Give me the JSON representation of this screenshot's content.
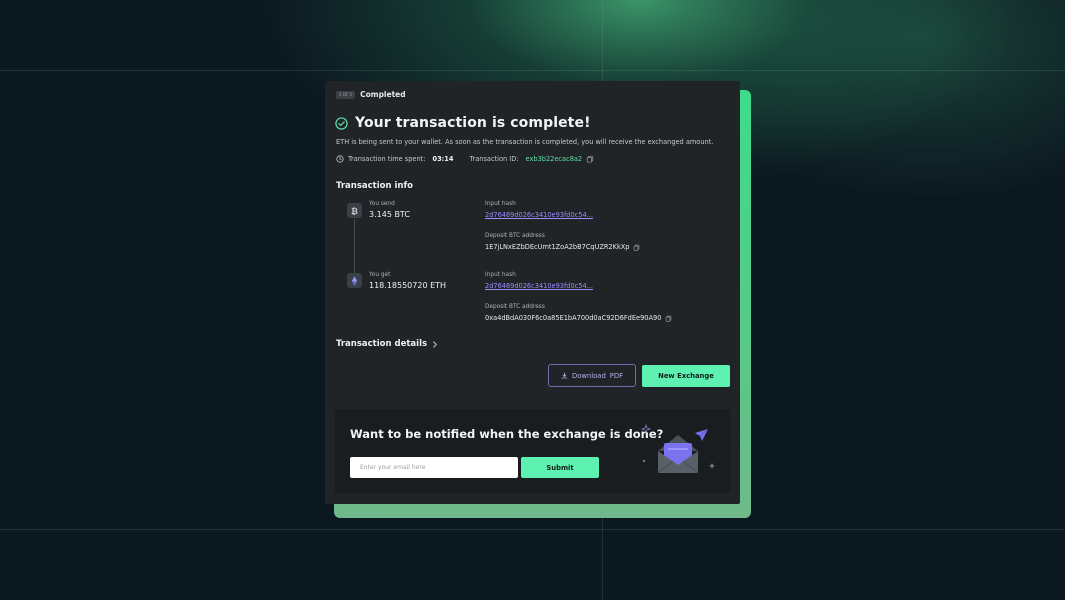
{
  "step": {
    "badge": "5 OF 5",
    "label": "Completed"
  },
  "header": {
    "title": "Your transaction is complete!",
    "subtitle": "ETH is being sent to your wallet. As soon as the transaction is completed, you will receive the exchanged amount."
  },
  "meta": {
    "time_label": "Transaction time spent:",
    "time_value": "03:14",
    "id_label": "Transaction ID:",
    "id_value": "exb3b22ecac8a2"
  },
  "transaction_info": {
    "title": "Transaction info",
    "send": {
      "label": "You send",
      "amount": "3.145 BTC",
      "hash_label": "Input hash",
      "hash": "2d76469d026c3410e93fd0c54...",
      "address_label": "Deposit BTC address",
      "address": "1E7jLNxEZbDEcUmt1ZoA2bB7CqUZR2KkXp"
    },
    "get": {
      "label": "You get",
      "amount": "118.18550720 ETH",
      "hash_label": "Input hash",
      "hash": "2d76469d026c3410e93fd0c54...",
      "address_label": "Deposit BTC address",
      "address": "0xa4dBdA030F6c0a85E1bA700d0aC92D6FdEe90A90"
    }
  },
  "details": {
    "label": "Transaction details"
  },
  "actions": {
    "download_label": "Download",
    "download_suffix": "PDF",
    "new_exchange_label": "New Exchange"
  },
  "notify": {
    "title": "Want to be notified when the exchange is done?",
    "email_placeholder": "Enter your email here",
    "submit_label": "Submit"
  },
  "colors": {
    "accent_green": "#5ef2b2",
    "link_purple": "#9b8cff",
    "card_bg": "#202427"
  },
  "icons": {
    "check": "check-circle-icon",
    "clock": "clock-icon",
    "copy": "copy-icon",
    "bitcoin": "bitcoin-icon",
    "ethereum": "ethereum-icon",
    "chevron": "chevron-right-icon",
    "download": "download-icon",
    "envelope": "envelope-icon"
  }
}
